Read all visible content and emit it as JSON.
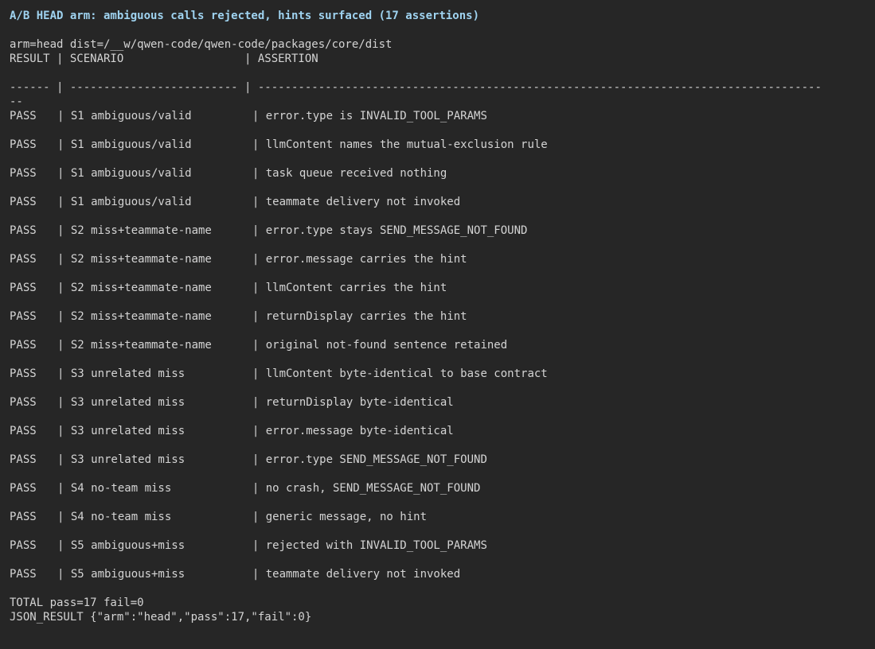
{
  "title": "A/B HEAD arm: ambiguous calls rejected, hints surfaced (17 assertions)",
  "meta_line": "arm=head dist=/__w/qwen-code/qwen-code/packages/core/dist",
  "header_line": "RESULT | SCENARIO                  | ASSERTION",
  "separator_line": "------ | ------------------------- | ------------------------------------------------------------------------------------",
  "separator_wrap": "--",
  "rows": [
    {
      "result": "PASS",
      "scenario": "S1 ambiguous/valid",
      "assertion": "error.type is INVALID_TOOL_PARAMS"
    },
    {
      "result": "PASS",
      "scenario": "S1 ambiguous/valid",
      "assertion": "llmContent names the mutual-exclusion rule"
    },
    {
      "result": "PASS",
      "scenario": "S1 ambiguous/valid",
      "assertion": "task queue received nothing"
    },
    {
      "result": "PASS",
      "scenario": "S1 ambiguous/valid",
      "assertion": "teammate delivery not invoked"
    },
    {
      "result": "PASS",
      "scenario": "S2 miss+teammate-name",
      "assertion": "error.type stays SEND_MESSAGE_NOT_FOUND"
    },
    {
      "result": "PASS",
      "scenario": "S2 miss+teammate-name",
      "assertion": "error.message carries the hint"
    },
    {
      "result": "PASS",
      "scenario": "S2 miss+teammate-name",
      "assertion": "llmContent carries the hint"
    },
    {
      "result": "PASS",
      "scenario": "S2 miss+teammate-name",
      "assertion": "returnDisplay carries the hint"
    },
    {
      "result": "PASS",
      "scenario": "S2 miss+teammate-name",
      "assertion": "original not-found sentence retained"
    },
    {
      "result": "PASS",
      "scenario": "S3 unrelated miss",
      "assertion": "llmContent byte-identical to base contract"
    },
    {
      "result": "PASS",
      "scenario": "S3 unrelated miss",
      "assertion": "returnDisplay byte-identical"
    },
    {
      "result": "PASS",
      "scenario": "S3 unrelated miss",
      "assertion": "error.message byte-identical"
    },
    {
      "result": "PASS",
      "scenario": "S3 unrelated miss",
      "assertion": "error.type SEND_MESSAGE_NOT_FOUND"
    },
    {
      "result": "PASS",
      "scenario": "S4 no-team miss",
      "assertion": "no crash, SEND_MESSAGE_NOT_FOUND"
    },
    {
      "result": "PASS",
      "scenario": "S4 no-team miss",
      "assertion": "generic message, no hint"
    },
    {
      "result": "PASS",
      "scenario": "S5 ambiguous+miss",
      "assertion": "rejected with INVALID_TOOL_PARAMS"
    },
    {
      "result": "PASS",
      "scenario": "S5 ambiguous+miss",
      "assertion": "teammate delivery not invoked"
    }
  ],
  "total_line": "TOTAL pass=17 fail=0",
  "json_result_line": "JSON_RESULT {\"arm\":\"head\",\"pass\":17,\"fail\":0}",
  "colors": {
    "background": "#262626",
    "text": "#d4d4d4",
    "title": "#9fd3f0"
  }
}
